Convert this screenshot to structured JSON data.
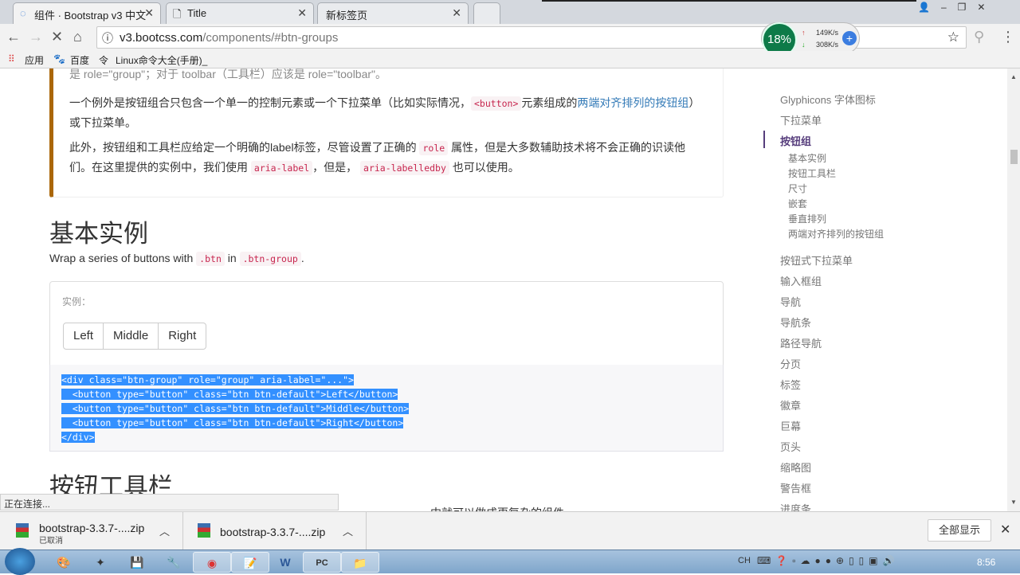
{
  "browser": {
    "tabs": [
      {
        "label": "组件 · Bootstrap v3 中文",
        "active": true
      },
      {
        "label": "Title"
      },
      {
        "label": "新标签页"
      }
    ],
    "url_host": "v3.bootcss.com",
    "url_path": "/components/#btn-groups",
    "bookmarks": [
      "应用",
      "百度",
      "Linux命令大全(手册)_"
    ],
    "speed_widget": {
      "percent": "18%",
      "up": "149K/s",
      "down": "308K/s"
    },
    "status": "正在连接..."
  },
  "content": {
    "callout": {
      "p0_tail": "是 role=\"group\"；对于 toolbar（工具栏）应该是 role=\"toolbar\"。",
      "p1_a": "一个例外是按钮组合只包含一个单一的控制元素或一个下拉菜单（比如实际情况，",
      "p1_code": "<button>",
      "p1_b": "元素组成的",
      "p1_link": "两端对齐排列的按钮组",
      "p1_c": "）或下拉菜单。",
      "p2_a": "此外，按钮组和工具栏应给定一个明确的label标签，尽管设置了正确的",
      "p2_code1": "role",
      "p2_b": "属性，但是大多数辅助技术将不会正确的识读他们。在这里提供的实例中，我们使用",
      "p2_code2": "aria-label",
      "p2_c": "，但是，",
      "p2_code3": "aria-labelledby",
      "p2_d": "也可以使用。"
    },
    "heading1": "基本实例",
    "intro_a": "Wrap a series of buttons with",
    "intro_code1": ".btn",
    "intro_b": "in",
    "intro_code2": ".btn-group",
    "example_label": "实例：",
    "buttons": [
      "Left",
      "Middle",
      "Right"
    ],
    "code_lines": [
      "<div class=\"btn-group\" role=\"group\" aria-label=\"...\">",
      "  <button type=\"button\" class=\"btn btn-default\">Left</button>",
      "  <button type=\"button\" class=\"btn btn-default\">Middle</button>",
      "  <button type=\"button\" class=\"btn btn-default\">Right</button>",
      "</div>"
    ],
    "heading2": "按钮工具栏",
    "partial_line": "中就可以做成更复杂的组件"
  },
  "sidebar": {
    "items": [
      "Glyphicons 字体图标",
      "下拉菜单",
      "按钮组"
    ],
    "subitems": [
      "基本实例",
      "按钮工具栏",
      "尺寸",
      "嵌套",
      "垂直排列",
      "两端对齐排列的按钮组"
    ],
    "items2": [
      "按钮式下拉菜单",
      "输入框组",
      "导航",
      "导航条",
      "路径导航",
      "分页",
      "标签",
      "徽章",
      "巨幕",
      "页头",
      "缩略图",
      "警告框",
      "进度条"
    ]
  },
  "downloads": {
    "items": [
      {
        "name": "bootstrap-3.3.7-....zip",
        "status": "已取消"
      },
      {
        "name": "bootstrap-3.3.7-....zip",
        "status": ""
      }
    ],
    "show_all": "全部显示"
  },
  "taskbar": {
    "clock": "8:56",
    "lang": "CH"
  },
  "colors": {
    "accent": "#563d7c",
    "callout_border": "#aa6708",
    "selection": "#3390ff",
    "link": "#337ab7"
  }
}
